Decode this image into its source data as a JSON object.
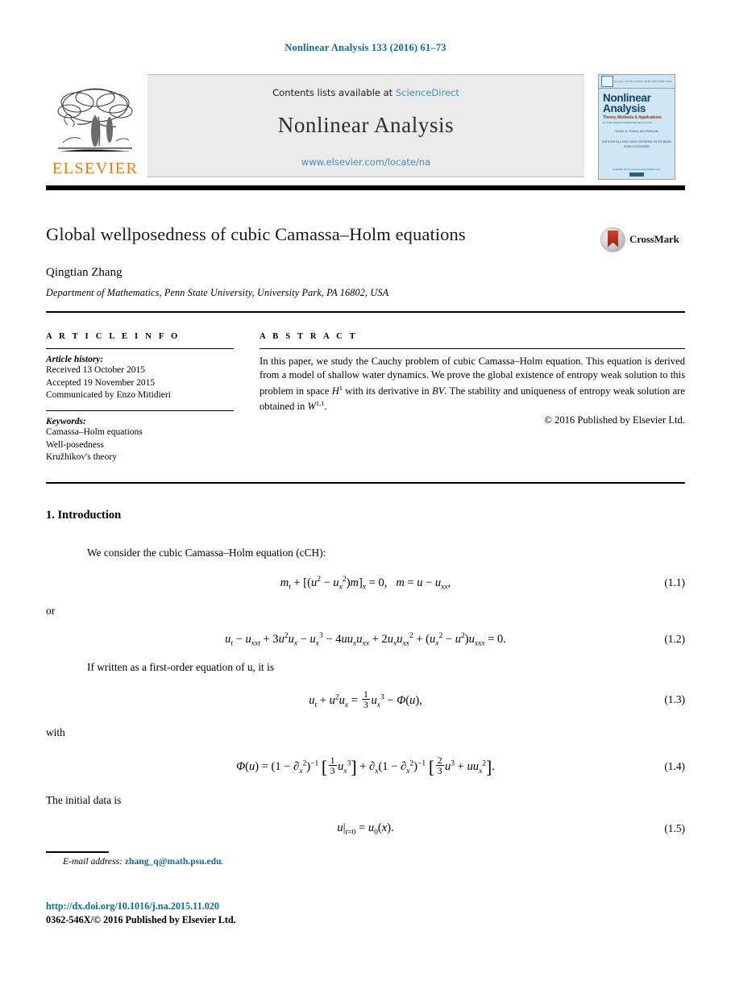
{
  "running_head": "Nonlinear Analysis 133 (2016) 61–73",
  "masthead": {
    "publisher_word": "ELSEVIER",
    "contents_prefix": "Contents lists available at ",
    "sciencedirect": "ScienceDirect",
    "journal_title": "Nonlinear Analysis",
    "journal_url": "www.elsevier.com/locate/na",
    "cover": {
      "top_left": "Volume 133",
      "top_mid": "November 2016",
      "top_right": "ISSN 0362-546X",
      "title": "Nonlinear Analysis",
      "subtitle": "Theory, Methods & Applications",
      "subtitle2": "An International Multidisciplinary Journal",
      "series": "Series A: Theory and Methods",
      "editors": "EDITORS-IN-CHIEF\nENZO MITIDIERI\nPIOTR BILER\nRON LUI ROSSIER",
      "footer": "Available online at www.sciencedirect.com"
    }
  },
  "article": {
    "title": "Global wellposedness of cubic Camassa–Holm equations",
    "crossmark_label": "CrossMark",
    "author": "Qingtian Zhang",
    "affiliation": "Department of Mathematics, Penn State University, University Park, PA 16802, USA"
  },
  "info": {
    "heading": "A R T I C L E   I N F O",
    "history_label": "Article history:",
    "history": [
      "Received 13 October 2015",
      "Accepted 19 November 2015",
      "Communicated by Enzo Mitidieri"
    ],
    "keywords_label": "Keywords:",
    "keywords": [
      "Camassa–Holm equations",
      "Well-posedness",
      "Kružhikov's theory"
    ]
  },
  "abstract": {
    "heading": "A B S T R A C T",
    "text_parts": {
      "p1": "In this paper, we study the Cauchy problem of cubic Camassa–Holm equation. This equation is derived from a model of shallow water dynamics. We prove the global existence of entropy weak solution to this problem in space ",
      "h1": "H",
      "h1_sup": "1",
      "p2": " with its derivative in ",
      "bv": "BV",
      "p3": ". The stability and uniqueness of entropy weak solution are obtained in ",
      "w": "W",
      "w_sup": "1,1",
      "p4": "."
    },
    "copyright": "© 2016 Published by Elsevier Ltd."
  },
  "body": {
    "section_number_title": "1. Introduction",
    "para_1": "We consider the cubic Camassa–Holm equation (cCH):",
    "para_or": "or",
    "para_2": "If written as a first-order equation of u, it is",
    "para_with": "with",
    "para_3": "The initial data is",
    "equations": {
      "eq1_num": "(1.1)",
      "eq2_num": "(1.2)",
      "eq3_num": "(1.3)",
      "eq4_num": "(1.4)",
      "eq5_num": "(1.5)"
    }
  },
  "footer": {
    "email_label": "E-mail address:",
    "email": "zhang_q@math.psu.edu",
    "email_period": ".",
    "doi": "http://dx.doi.org/10.1016/j.na.2015.11.020",
    "issn_line": "0362-546X/© 2016 Published by Elsevier Ltd."
  },
  "colors": {
    "link_blue": "#0b6d9e",
    "sciencedirect_blue": "#3a8fc4",
    "elsevier_orange": "#f07f13",
    "banner_grey": "#ebebeb"
  }
}
